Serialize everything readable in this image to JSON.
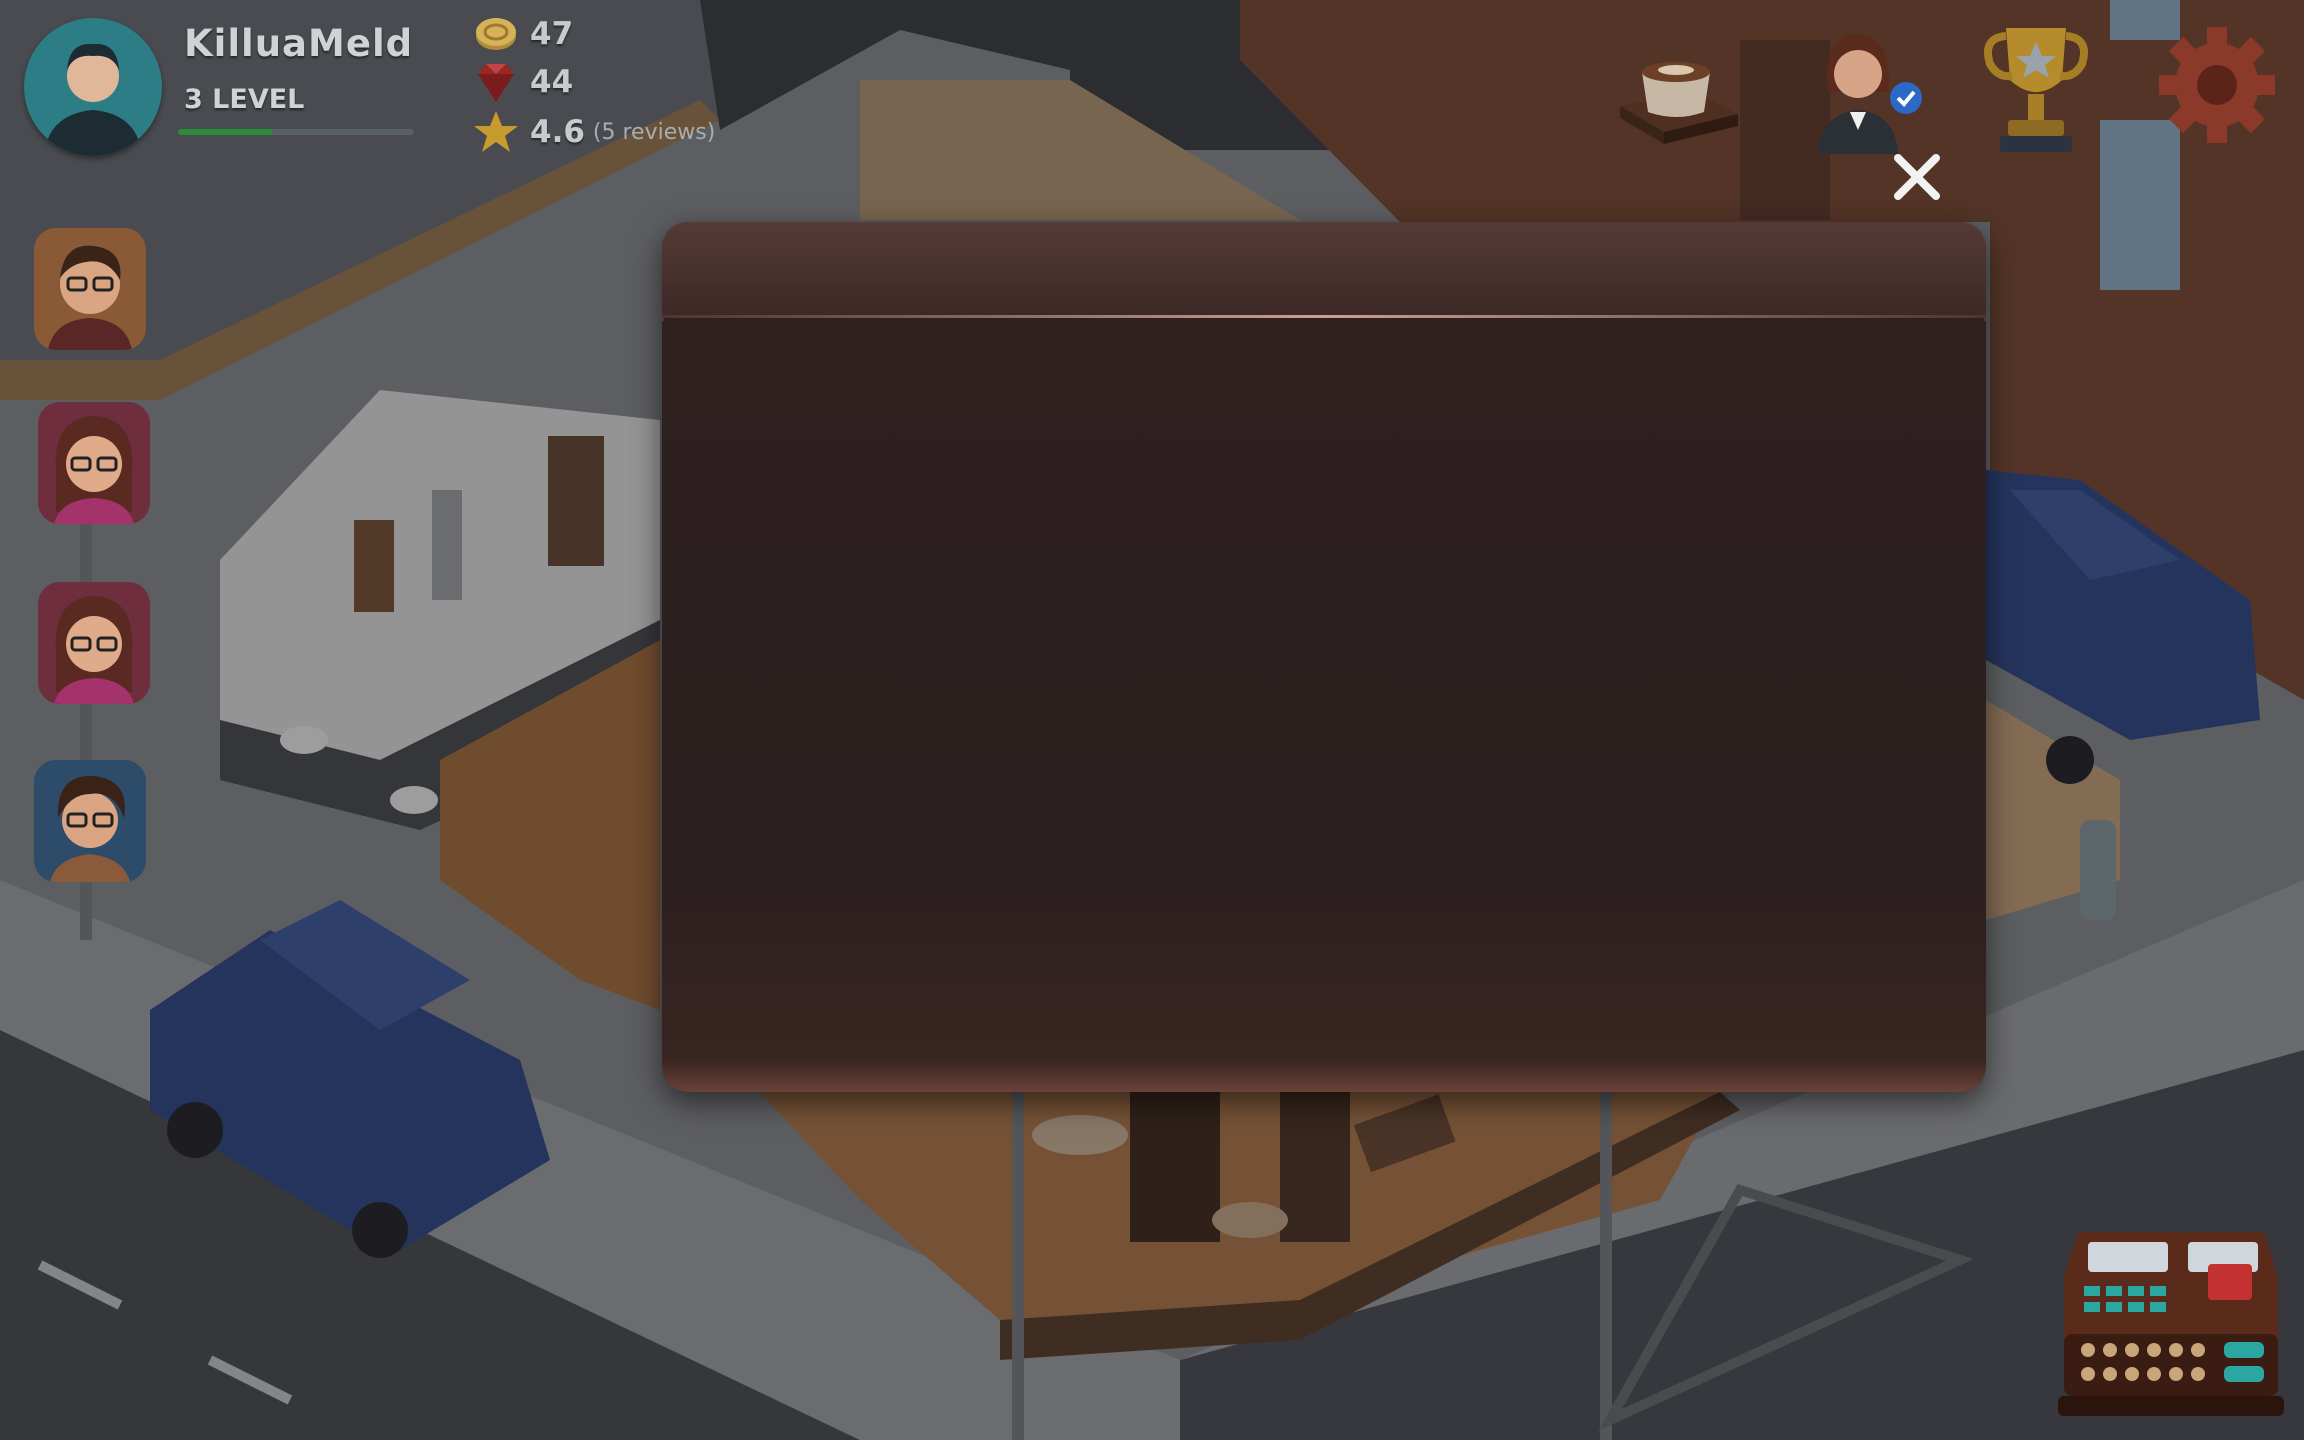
{
  "player": {
    "name": "KilluaMeld",
    "level_label": "3 LEVEL",
    "xp_progress": 0.4
  },
  "stats": {
    "coins": "47",
    "gems": "44",
    "rating": "4.6",
    "reviews": "(5 reviews)"
  },
  "customers": [
    {
      "icon": "customer-man-glasses-icon"
    },
    {
      "icon": "customer-woman-glasses-icon"
    },
    {
      "icon": "customer-woman-glasses-icon"
    },
    {
      "icon": "customer-boy-glasses-icon"
    }
  ],
  "top_icons": [
    "coffee-cup-icon",
    "manager-icon",
    "trophy-icon",
    "settings-gear-icon"
  ],
  "dialog": {
    "close_icon": "close-icon"
  },
  "bottom_right": {
    "icon": "cash-register-icon"
  },
  "colors": {
    "dialog_bg": "#2e2020",
    "dialog_header": "#553a36",
    "xp_bar": "#2c8a3c",
    "avatar_bg": "#2d7d86"
  }
}
